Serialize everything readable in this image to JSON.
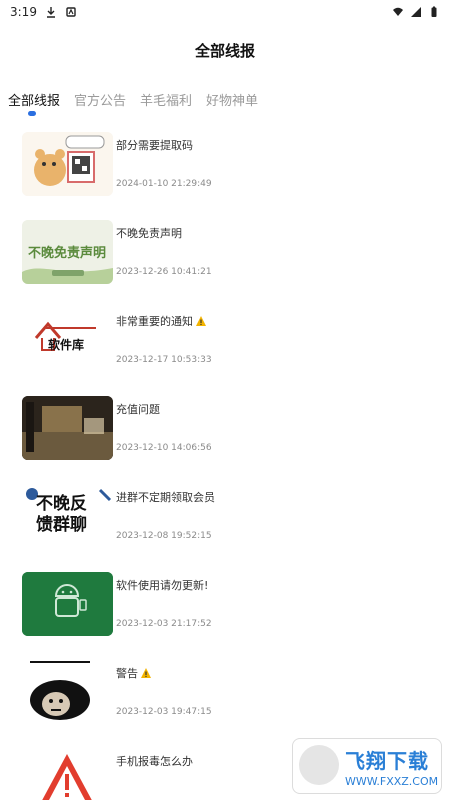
{
  "status_bar": {
    "time": "3:19"
  },
  "header": {
    "title": "全部线报"
  },
  "tabs": [
    {
      "label": "全部线报",
      "active": true
    },
    {
      "label": "官方公告",
      "active": false
    },
    {
      "label": "羊毛福利",
      "active": false
    },
    {
      "label": "好物神单",
      "active": false
    }
  ],
  "items": [
    {
      "title": "部分需要提取码",
      "date": "2024-01-10 21:29:49",
      "thumb_text": ""
    },
    {
      "title": "不晚免责声明",
      "date": "2023-12-26 10:41:21",
      "thumb_text": "不晚免责声明"
    },
    {
      "title": "非常重要的通知",
      "date": "2023-12-17 10:53:33",
      "thumb_text": "软件库"
    },
    {
      "title": "充值问题",
      "date": "2023-12-10 14:06:56",
      "thumb_text": ""
    },
    {
      "title": "进群不定期领取会员",
      "date": "2023-12-08 19:52:15",
      "thumb_text": "不晚反馈群聊"
    },
    {
      "title": "软件使用请勿更新!",
      "date": "2023-12-03 21:17:52",
      "thumb_text": ""
    },
    {
      "title": "警告",
      "date": "2023-12-03 19:47:15",
      "thumb_text": ""
    },
    {
      "title": "手机报毒怎么办",
      "date": "",
      "thumb_text": ""
    }
  ],
  "watermark": {
    "text": "飞翔下载",
    "url": "WWW.FXXZ.COM"
  },
  "colors": {
    "accent": "#2b6fe0",
    "watermark": "#2a7fd6"
  }
}
